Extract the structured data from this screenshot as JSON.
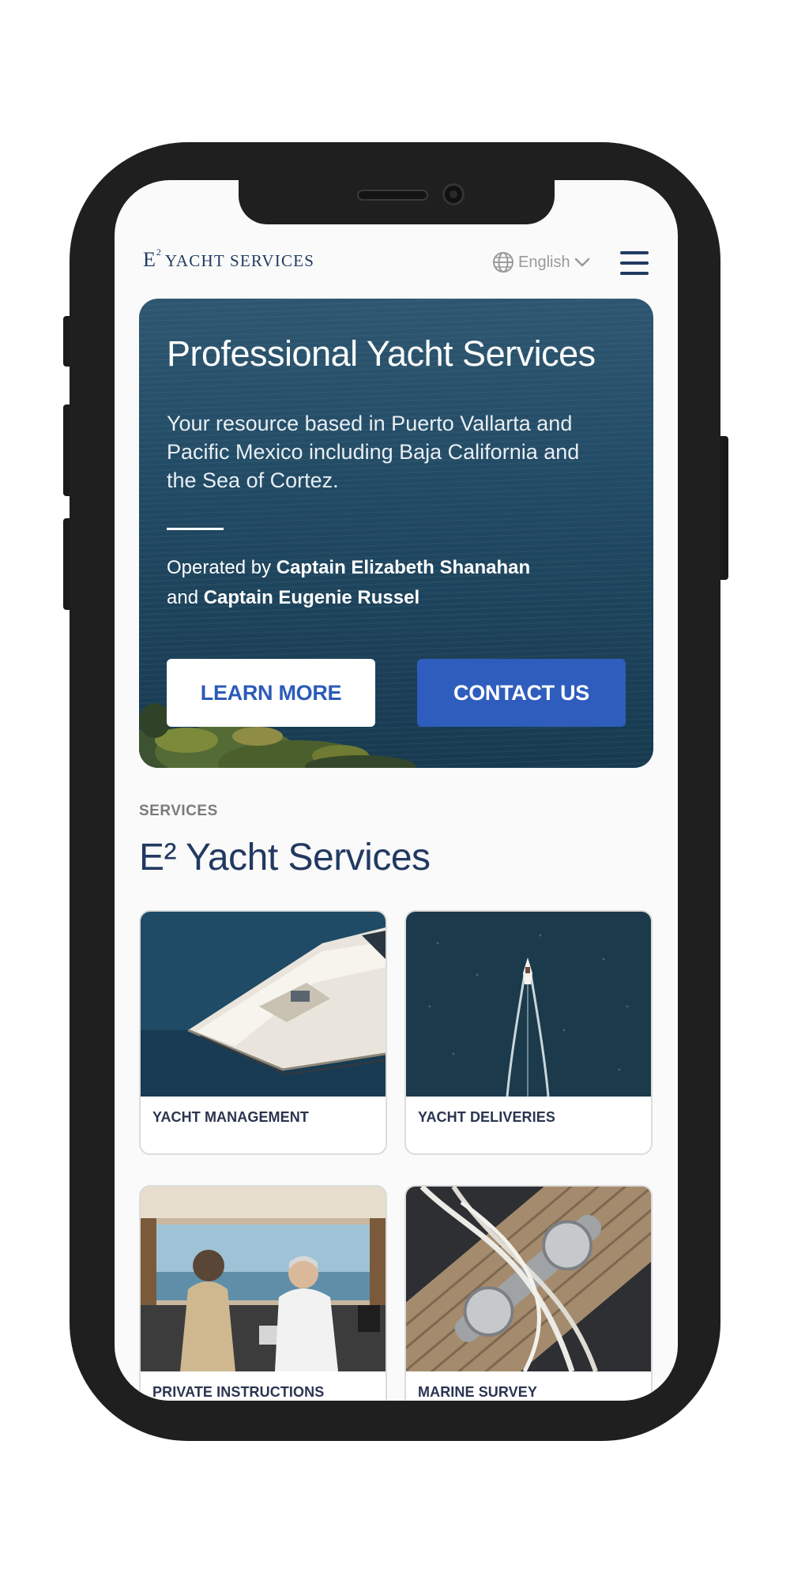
{
  "header": {
    "logo_mark": "E",
    "logo_superscript": "2",
    "logo_text": "YACHT SERVICES",
    "language_label": "English",
    "language_icon": "globe-icon",
    "menu_icon": "hamburger-menu-icon"
  },
  "hero": {
    "title": "Professional Yacht Services",
    "description": "Your resource based in Puerto Vallarta and Pacific Mexico including Baja California and the Sea of Cortez.",
    "operated_prefix": "Operated by ",
    "captain_1": "Captain Elizabeth Shanahan",
    "operated_join": " and ",
    "captain_2": "Captain Eugenie Russel",
    "learn_more_label": "LEARN MORE",
    "contact_us_label": "CONTACT US"
  },
  "services": {
    "eyebrow": "SERVICES",
    "title": "E² Yacht Services",
    "cards": [
      {
        "label": "YACHT MANAGEMENT"
      },
      {
        "label": "YACHT DELIVERIES"
      },
      {
        "label": "PRIVATE INSTRUCTIONS"
      },
      {
        "label": "MARINE SURVEY"
      }
    ]
  },
  "colors": {
    "brand_navy": "#223a62",
    "accent_blue": "#2f5dbd",
    "hero_water": "#214a64"
  }
}
